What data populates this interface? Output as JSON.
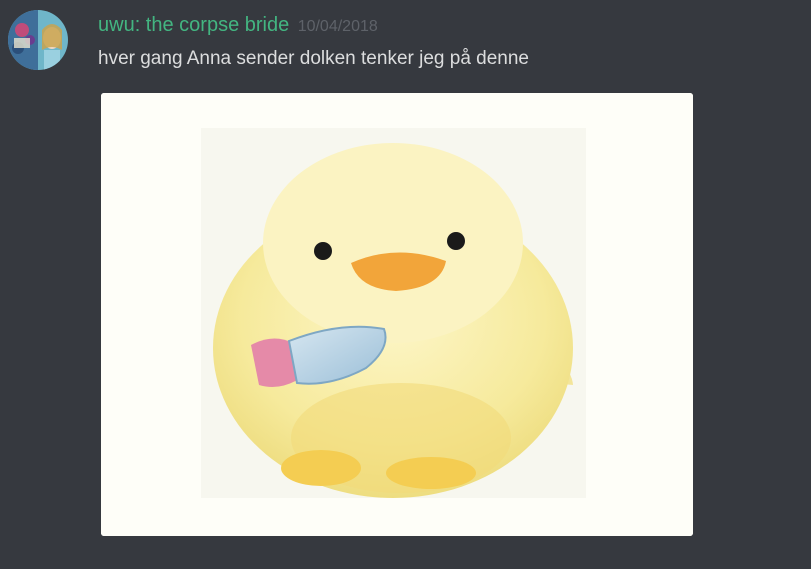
{
  "message": {
    "author": "uwu: the corpse bride",
    "timestamp": "10/04/2018",
    "content": "hver gang Anna sender dolken tenker jeg på denne",
    "avatar_icon": "user-avatar-icon",
    "attachment_icon": "chick-with-knife-image"
  },
  "colors": {
    "background": "#36393f",
    "username": "#43b581",
    "timestamp": "#5e6269",
    "text": "#dcddde"
  }
}
